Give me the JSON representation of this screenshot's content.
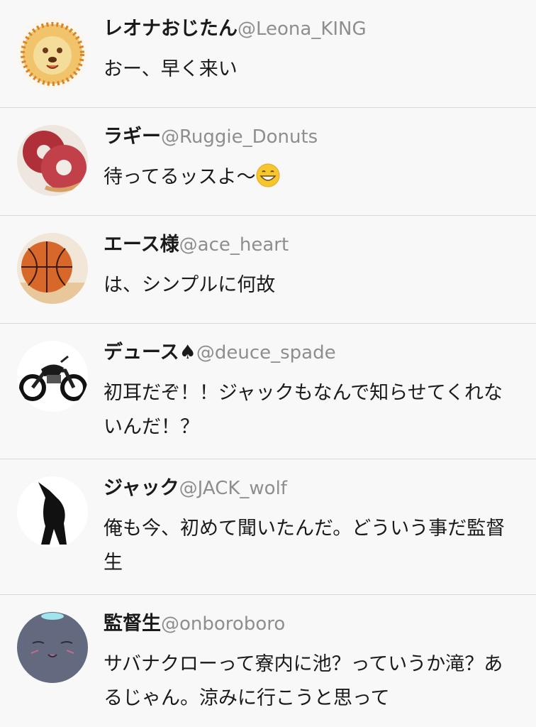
{
  "posts": [
    {
      "name": "レオナおじたん",
      "handle": "@Leona_KING",
      "text": "おー、早く来い",
      "avatar_icon": "lion-avatar-icon"
    },
    {
      "name": "ラギー",
      "handle": "@Ruggie_Donuts",
      "text": "待ってるッスよ〜",
      "emoji": "grinning-face-icon",
      "avatar_icon": "donuts-avatar-icon"
    },
    {
      "name": "エース様",
      "handle": "@ace_heart",
      "text": "は、シンプルに何故",
      "avatar_icon": "basketball-avatar-icon"
    },
    {
      "name": "デュース♠",
      "handle": "@deuce_spade",
      "text": "初耳だぞ！！ジャックもなんで知らせてくれないんだ！？",
      "avatar_icon": "motorcycle-avatar-icon"
    },
    {
      "name": "ジャック",
      "handle": "@JACK_wolf",
      "text": "俺も今、初めて聞いたんだ。どういう事だ監督生",
      "avatar_icon": "wolf-avatar-icon"
    },
    {
      "name": "監督生",
      "handle": "@onboroboro",
      "text": "サバナクローって寮内に池？っていうか滝？あるじゃん。涼みに行こうと思って",
      "avatar_icon": "ghost-avatar-icon"
    }
  ],
  "colors": {
    "background": "#f8f8f8",
    "divider": "#d8d8d8",
    "name": "#1a1a1a",
    "handle": "#8e8e8e"
  }
}
